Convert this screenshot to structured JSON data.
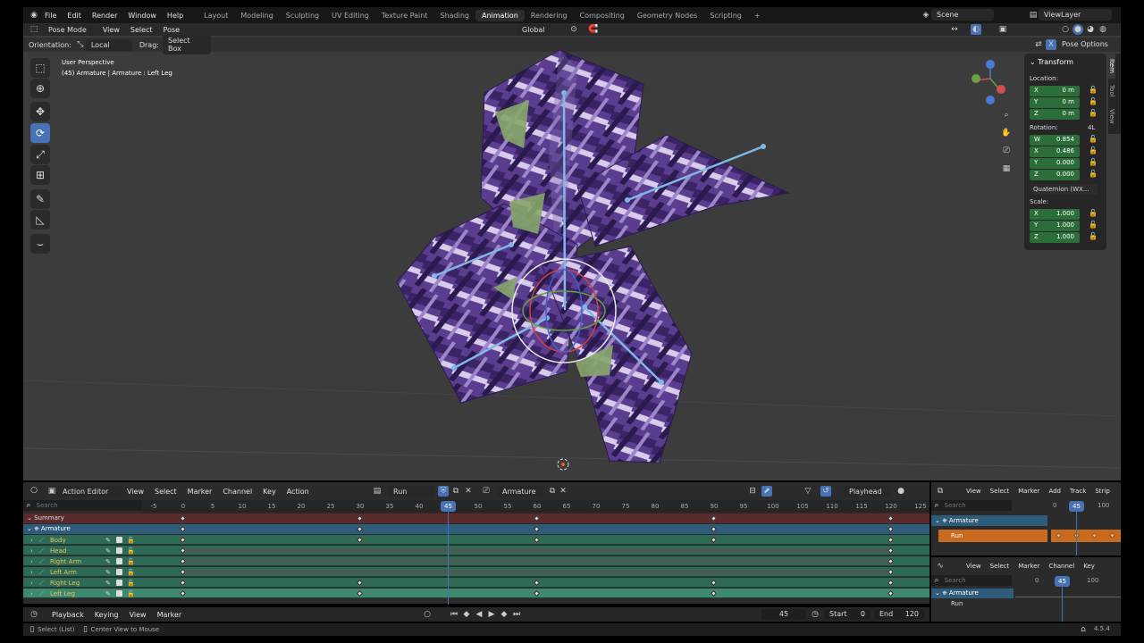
{
  "app": {
    "menu": [
      "File",
      "Edit",
      "Render",
      "Window",
      "Help"
    ],
    "workspaces": [
      {
        "label": "Layout",
        "active": false
      },
      {
        "label": "Modeling",
        "active": false
      },
      {
        "label": "Sculpting",
        "active": false
      },
      {
        "label": "UV Editing",
        "active": false
      },
      {
        "label": "Texture Paint",
        "active": false
      },
      {
        "label": "Shading",
        "active": false
      },
      {
        "label": "Animation",
        "active": true
      },
      {
        "label": "Rendering",
        "active": false
      },
      {
        "label": "Compositing",
        "active": false
      },
      {
        "label": "Geometry Nodes",
        "active": false
      },
      {
        "label": "Scripting",
        "active": false
      }
    ],
    "add_workspace": "+",
    "scene": "Scene",
    "view_layer": "ViewLayer"
  },
  "viewport_header": {
    "mode": "Pose Mode",
    "menus": [
      "View",
      "Select",
      "Pose"
    ],
    "transform_orientation": "Global",
    "pose_options": "Pose Options"
  },
  "tool_header": {
    "orientation_label": "Orientation:",
    "orientation_value": "Local",
    "drag_label": "Drag:",
    "drag_value": "Select Box"
  },
  "viewport": {
    "title": "User Perspective",
    "subtitle": "(45) Armature | Armature : Left Leg"
  },
  "sidebar": {
    "panel_title": "Transform",
    "location_label": "Location:",
    "location": [
      {
        "axis": "X",
        "value": "0 m"
      },
      {
        "axis": "Y",
        "value": "0 m"
      },
      {
        "axis": "Z",
        "value": "0 m"
      }
    ],
    "rotation_label": "Rotation:",
    "rotation_mode_short": "4L",
    "rotation": [
      {
        "axis": "W",
        "value": "0.854"
      },
      {
        "axis": "X",
        "value": "0.486"
      },
      {
        "axis": "Y",
        "value": "0.000"
      },
      {
        "axis": "Z",
        "value": "0.000"
      }
    ],
    "rotation_mode": "Quaternion (WX...",
    "scale_label": "Scale:",
    "scale": [
      {
        "axis": "X",
        "value": "1.000"
      },
      {
        "axis": "Y",
        "value": "1.000"
      },
      {
        "axis": "Z",
        "value": "1.000"
      }
    ],
    "tabs": [
      "Item",
      "Tool",
      "View"
    ]
  },
  "action_editor": {
    "editor_mode": "Action Editor",
    "menus": [
      "View",
      "Select",
      "Marker",
      "Channel",
      "Key",
      "Action"
    ],
    "action_name": "Run",
    "object_name": "Armature",
    "snap_mode": "Playhead",
    "search_placeholder": "Search",
    "frame_ticks": [
      "-5",
      "0",
      "5",
      "10",
      "15",
      "20",
      "25",
      "30",
      "35",
      "40",
      "45",
      "50",
      "55",
      "60",
      "65",
      "70",
      "75",
      "80",
      "85",
      "90",
      "95",
      "100",
      "105",
      "110",
      "115",
      "120",
      "125"
    ],
    "current_frame": "45",
    "summary_label": "Summary",
    "object_label": "Armature",
    "channels": [
      {
        "name": "Body",
        "keys": [
          0,
          30,
          60,
          90,
          120
        ]
      },
      {
        "name": "Head",
        "keys": [
          0,
          120
        ]
      },
      {
        "name": "Right Arm",
        "keys": [
          0,
          120
        ]
      },
      {
        "name": "Left Arm",
        "keys": [
          0,
          120
        ]
      },
      {
        "name": "Right Leg",
        "keys": [
          0,
          30,
          60,
          90,
          120
        ]
      },
      {
        "name": "Left Leg",
        "keys": [
          0,
          30,
          60,
          90,
          120
        ]
      }
    ],
    "summary_keys": [
      0,
      30,
      60,
      90,
      120
    ]
  },
  "timeline": {
    "menus": [
      "Playback",
      "Keying",
      "View",
      "Marker"
    ],
    "current_frame": "45",
    "start_label": "Start",
    "start": "0",
    "end_label": "End",
    "end": "120"
  },
  "nla_editor": {
    "menus": [
      "View",
      "Select",
      "Marker",
      "Add",
      "Track",
      "Strip"
    ],
    "search_placeholder": "Search",
    "ticks": [
      "0",
      "45",
      "100"
    ],
    "object_label": "Armature",
    "strip_label": "Run"
  },
  "graph_editor": {
    "menus": [
      "View",
      "Select",
      "Marker",
      "Channel",
      "Key"
    ],
    "search_placeholder": "Search",
    "ticks": [
      "0",
      "45",
      "100"
    ],
    "object_label": "Armature",
    "action_label": "Run"
  },
  "statusbar": {
    "hint1": "Select (List)",
    "hint2": "Center View to Mouse",
    "version": "4.5.4"
  },
  "colors": {
    "accent": "#4772b3",
    "channel_bg": "#2d6b57",
    "summary_bg": "#5b2a2a",
    "object_bg": "#2f5c7a",
    "field_green": "#2c6e3a",
    "nla_strip": "#c96b1f"
  }
}
